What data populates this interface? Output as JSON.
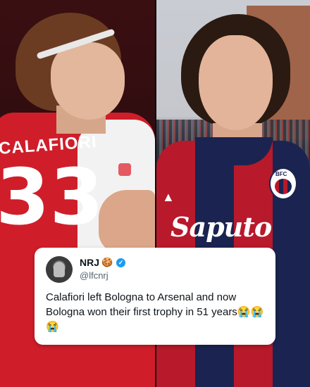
{
  "left_photo": {
    "jersey_name": "CALAFIORI",
    "jersey_number": "33",
    "colors": {
      "shirt": "#cf1e2a",
      "sleeve": "#f2f2f2"
    }
  },
  "right_photo": {
    "sponsor": "Saputo",
    "crest_text": "BFC",
    "colors": {
      "red": "#b8192b",
      "navy": "#1b2450"
    }
  },
  "tweet": {
    "display_name": "NRJ",
    "name_emoji": "🍪",
    "handle": "@lfcnrj",
    "verified": true,
    "text": "Calafiori left Bologna to Arsenal and now Bologna won their first trophy in 51 years😭😭😭",
    "accent_color": "#1d9bf0"
  }
}
